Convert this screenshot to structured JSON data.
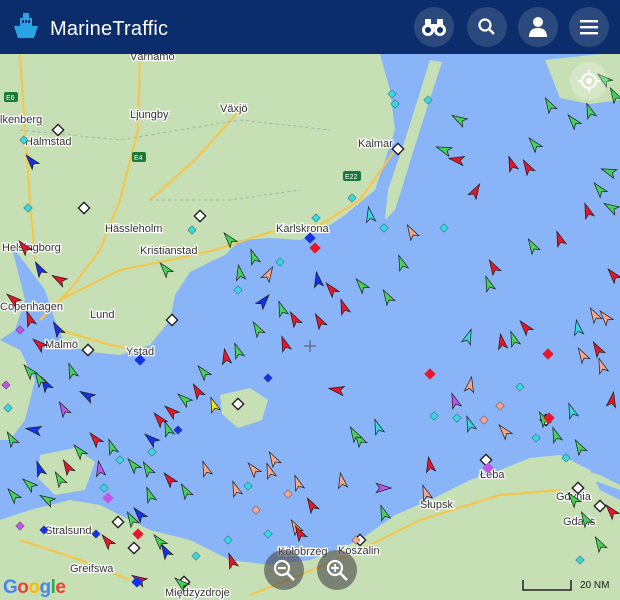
{
  "header": {
    "brand": "MarineTraffic"
  },
  "cities": [
    {
      "id": "vaxjo",
      "name": "Växjö"
    },
    {
      "id": "ljungby",
      "name": "Ljungby"
    },
    {
      "id": "halmstad",
      "name": "Halmstad"
    },
    {
      "id": "kalmar",
      "name": "Kalmar"
    },
    {
      "id": "hassleholm",
      "name": "Hässleholm"
    },
    {
      "id": "kristianstad",
      "name": "Kristianstad"
    },
    {
      "id": "karlskrona",
      "name": "Karlskrona"
    },
    {
      "id": "helsingborg",
      "name": "Helsingborg"
    },
    {
      "id": "copenhagen",
      "name": "Copenhagen"
    },
    {
      "id": "lund",
      "name": "Lund"
    },
    {
      "id": "malmo",
      "name": "Malmö"
    },
    {
      "id": "ystad",
      "name": "Ystad"
    },
    {
      "id": "stralsund",
      "name": "Stralsund"
    },
    {
      "id": "greifswald",
      "name": "Greifswa"
    },
    {
      "id": "koszalin",
      "name": "Koszalin"
    },
    {
      "id": "kolobrzeg",
      "name": "Kołobrzeg"
    },
    {
      "id": "slupsk",
      "name": "Słupsk"
    },
    {
      "id": "leba",
      "name": "Łeba"
    },
    {
      "id": "gdynia",
      "name": "Gdynia"
    },
    {
      "id": "gdansk",
      "name": "Gdańs"
    },
    {
      "id": "miedzyzdroje",
      "name": "Międzyzdroje"
    },
    {
      "id": "varnamo",
      "name": "Värnamo"
    },
    {
      "id": "falkenberg",
      "name": "lkenberg"
    }
  ],
  "roads": {
    "e4": "E4",
    "e6": "E6",
    "e22": "E22"
  },
  "scale": {
    "label": "20 NM"
  },
  "attribution": {
    "google": "Google"
  },
  "colors": {
    "sea": "#8ab4f8",
    "land": "#c7dfb4",
    "header": "#0c2d6b",
    "cargo": "#47d35a",
    "tanker": "#e8162b",
    "passenger": "#1532e8",
    "fishing": "#f4a58a",
    "tug": "#38d8e0",
    "pleasure": "#c056e8"
  }
}
